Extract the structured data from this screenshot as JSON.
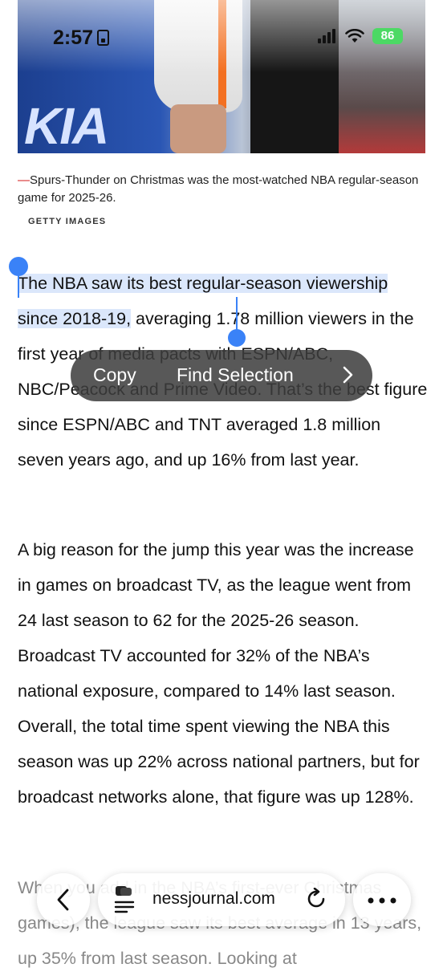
{
  "status_bar": {
    "time": "2:57",
    "battery": "86"
  },
  "photo": {
    "logo_text": "KIA"
  },
  "caption": {
    "text": "Spurs-Thunder on Christmas was the most-watched NBA regular-season game for 2025-26.",
    "credit": "GETTY IMAGES"
  },
  "article": {
    "p1_selected": "The NBA saw its best regular-season viewership since 2018-19,",
    "p1_rest": " averaging 1.78 million viewers in the first year of media pacts with ESPN/ABC, NBC/Peacock and Prime Video. That’s the best figure since ESPN/ABC and TNT averaged 1.8 million seven years ago, and up 16% from last year.",
    "p2": "A big reason for the jump this year was the increase in games on broadcast TV, as the league went from 24 last season to 62 for the 2025-26 season. Broadcast TV accounted for 32% of the NBA’s national exposure, compared to 14% last season. Overall, the total time spent viewing the NBA this season was up 22% across national partners, but for broadcast networks alone, that figure was up 128%.",
    "p3": "When you add in the NBA’s first-ever Christmas games), the league saw its best average in 13 years, up 35% from last season. Looking at"
  },
  "context_menu": {
    "copy": "Copy",
    "find_selection": "Find Selection"
  },
  "browser": {
    "url": "nessjournal.com"
  }
}
